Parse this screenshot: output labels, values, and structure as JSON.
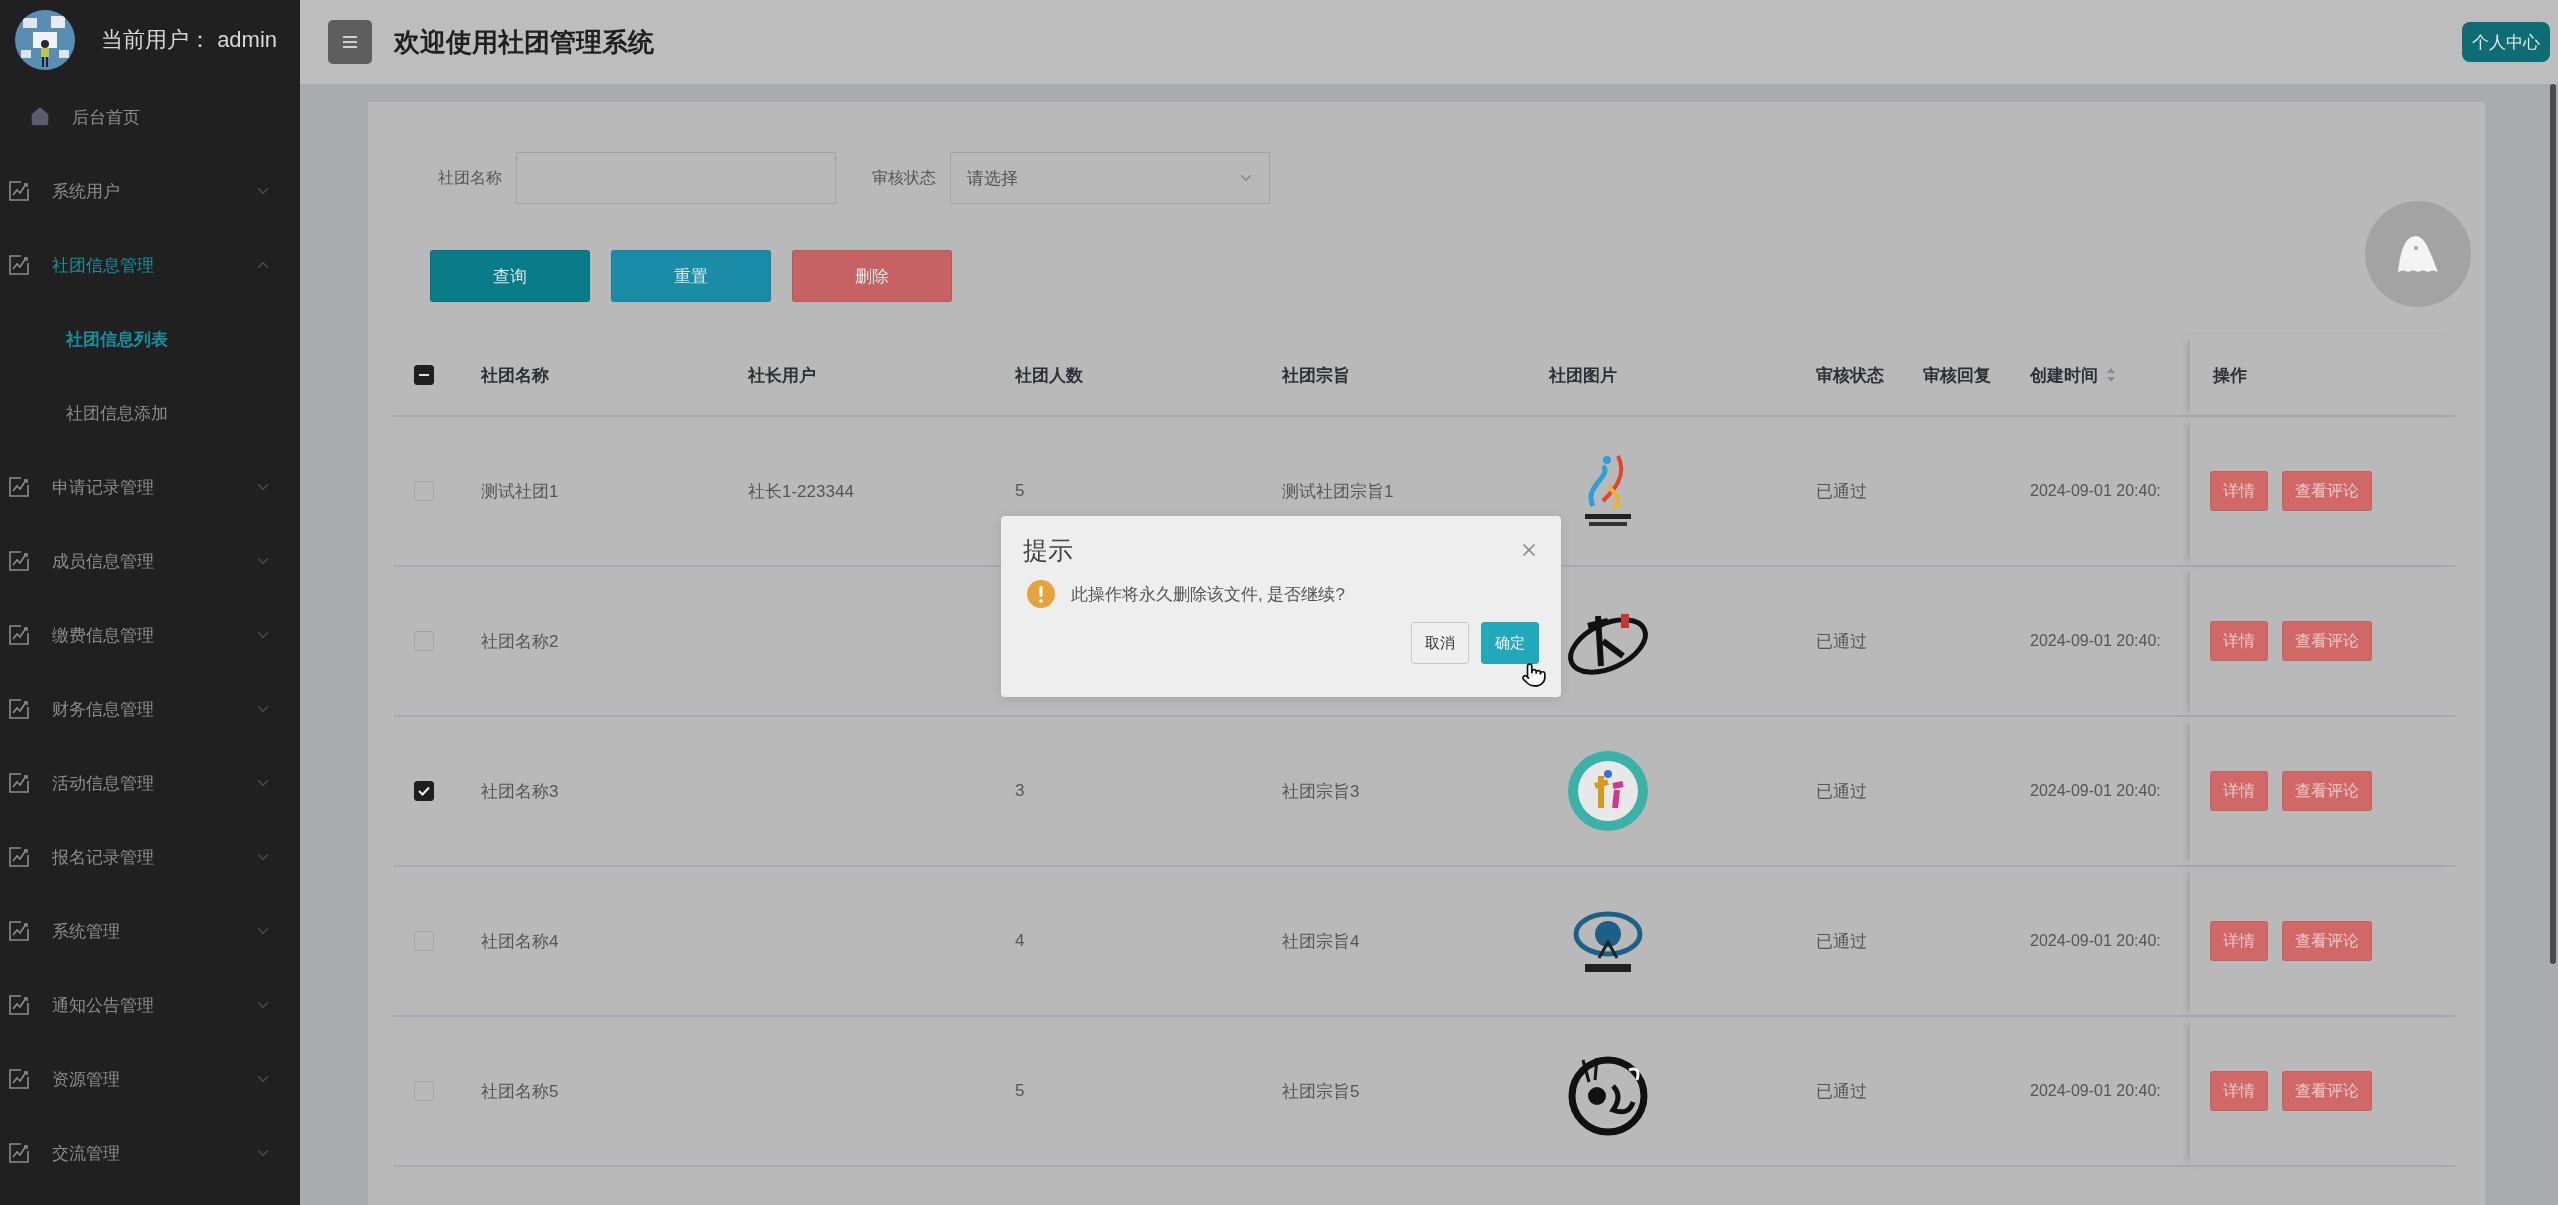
{
  "sidebar": {
    "user_label": "当前用户：",
    "username": "admin",
    "items": [
      {
        "label": "后台首页",
        "kind": "home"
      },
      {
        "label": "系统用户",
        "kind": "group",
        "expanded": false
      },
      {
        "label": "社团信息管理",
        "kind": "group",
        "expanded": true,
        "children": [
          {
            "label": "社团信息列表",
            "selected": true
          },
          {
            "label": "社团信息添加",
            "selected": false
          }
        ]
      },
      {
        "label": "申请记录管理",
        "kind": "group",
        "expanded": false
      },
      {
        "label": "成员信息管理",
        "kind": "group",
        "expanded": false
      },
      {
        "label": "缴费信息管理",
        "kind": "group",
        "expanded": false
      },
      {
        "label": "财务信息管理",
        "kind": "group",
        "expanded": false
      },
      {
        "label": "活动信息管理",
        "kind": "group",
        "expanded": false
      },
      {
        "label": "报名记录管理",
        "kind": "group",
        "expanded": false
      },
      {
        "label": "系统管理",
        "kind": "group",
        "expanded": false
      },
      {
        "label": "通知公告管理",
        "kind": "group",
        "expanded": false
      },
      {
        "label": "资源管理",
        "kind": "group",
        "expanded": false
      },
      {
        "label": "交流管理",
        "kind": "group",
        "expanded": false
      }
    ]
  },
  "header": {
    "title": "欢迎使用社团管理系统",
    "profile_button": "个人中心"
  },
  "filters": [
    {
      "label": "社团名称",
      "kind": "input"
    },
    {
      "label": "审核状态",
      "kind": "select",
      "placeholder": "请选择"
    }
  ],
  "buttons": [
    {
      "label": "查询",
      "kind": "primary"
    },
    {
      "label": "重置",
      "kind": "secondary"
    },
    {
      "label": "删除",
      "kind": "danger"
    }
  ],
  "table": {
    "select_all_indeterminate": true,
    "columns": [
      {
        "label": "社团名称"
      },
      {
        "label": "社长用户"
      },
      {
        "label": "社团人数"
      },
      {
        "label": "社团宗旨"
      },
      {
        "label": "社团图片"
      },
      {
        "label": "审核状态"
      },
      {
        "label": "审核回复"
      },
      {
        "label": "创建时间",
        "sortable": true
      },
      {
        "label": "操作"
      }
    ],
    "rows": [
      {
        "checked": false,
        "name": "测试社团1",
        "leader": "社长1-223344",
        "members": "5",
        "purpose": "测试社团宗旨1",
        "image": {
          "kind": "picture"
        },
        "status": "已通过",
        "created": "2024-09-01 20:40:",
        "actions": [
          "详情",
          "查看评论"
        ]
      },
      {
        "checked": false,
        "name": "社团名称2",
        "image": {
          "kind": "picture"
        },
        "status": "已通过",
        "created": "2024-09-01 20:40:",
        "actions": [
          "详情",
          "查看评论"
        ]
      },
      {
        "checked": true,
        "name": "社团名称3",
        "members": "3",
        "purpose": "社团宗旨3",
        "image": {
          "kind": "picture"
        },
        "status": "已通过",
        "created": "2024-09-01 20:40:",
        "actions": [
          "详情",
          "查看评论"
        ]
      },
      {
        "checked": false,
        "name": "社团名称4",
        "members": "4",
        "purpose": "社团宗旨4",
        "image": {
          "kind": "picture"
        },
        "status": "已通过",
        "created": "2024-09-01 20:40:",
        "actions": [
          "详情",
          "查看评论"
        ]
      },
      {
        "checked": false,
        "name": "社团名称5",
        "members": "5",
        "purpose": "社团宗旨5",
        "image": {
          "kind": "picture"
        },
        "status": "已通过",
        "created": "2024-09-01 20:40:",
        "actions": [
          "详情",
          "查看评论"
        ]
      }
    ]
  },
  "dialog": {
    "title": "提示",
    "message": "此操作将永久删除该文件, 是否继续?",
    "buttons": [
      {
        "label": "取消",
        "kind": "default"
      },
      {
        "label": "确定",
        "kind": "primary"
      }
    ]
  }
}
